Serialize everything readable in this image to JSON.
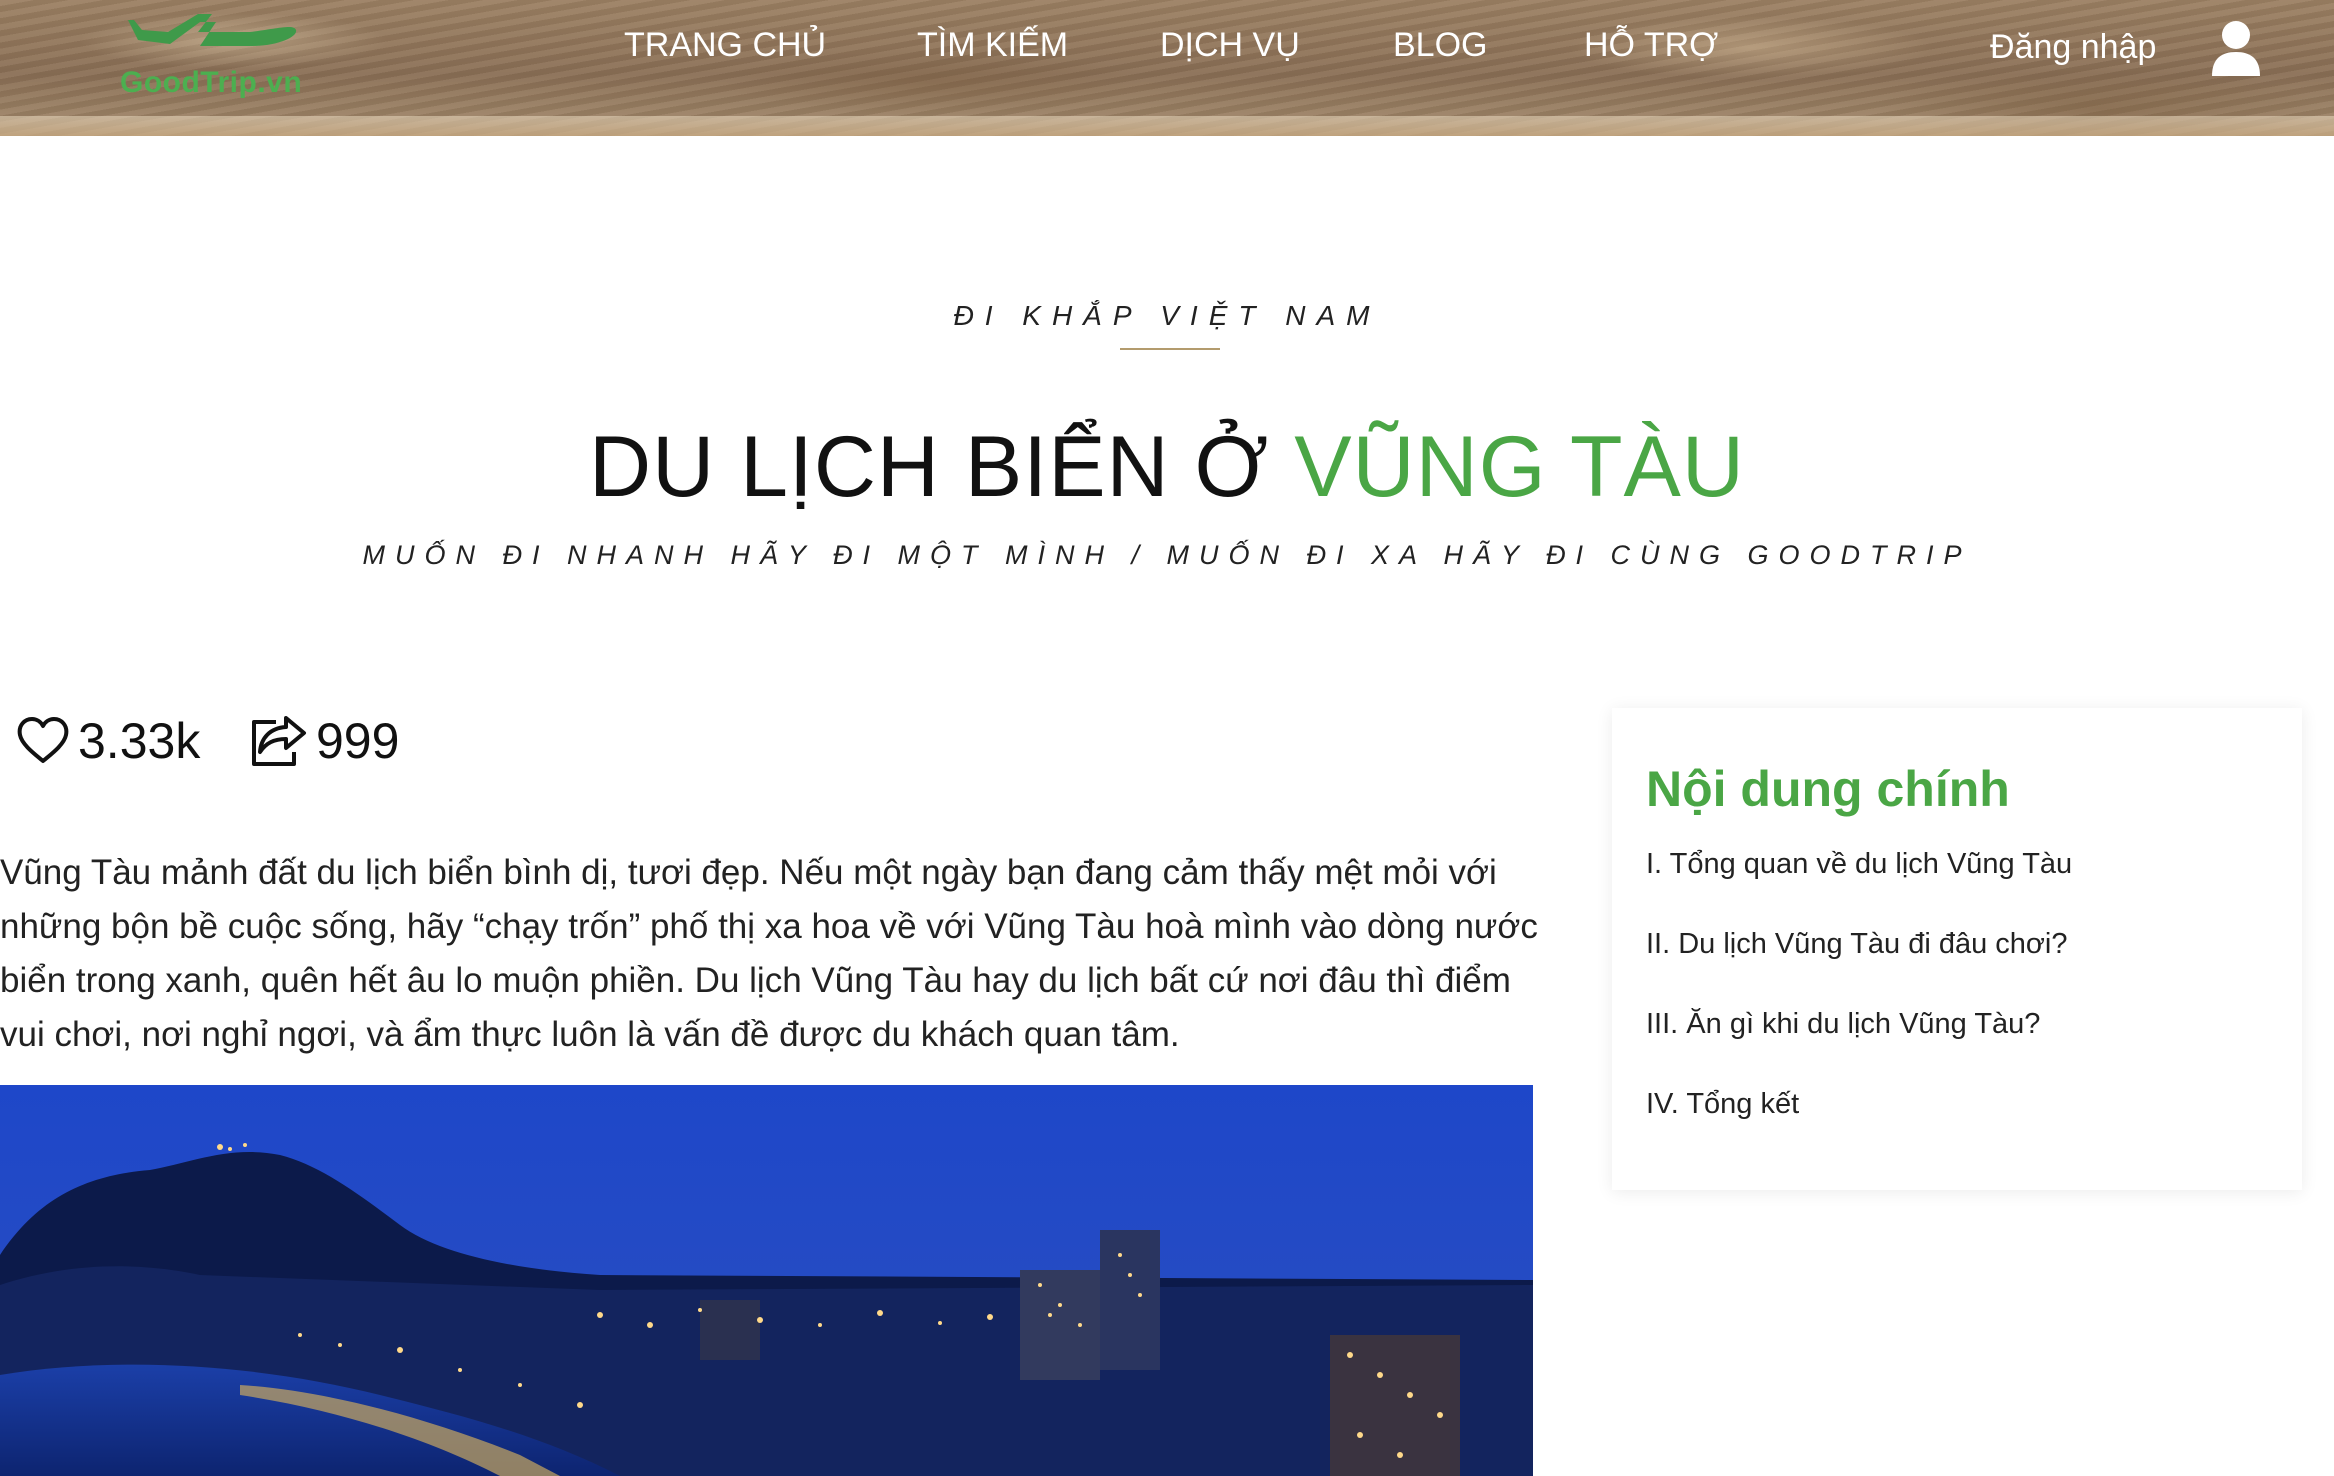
{
  "header": {
    "logo_text": "GoodTrip.vn",
    "nav": [
      {
        "label": "TRANG CHỦ"
      },
      {
        "label": "TÌM KIẾM"
      },
      {
        "label": "DỊCH VỤ"
      },
      {
        "label": "BLOG"
      },
      {
        "label": "HỖ TRỢ"
      }
    ],
    "login_label": "Đăng nhập",
    "icons": {
      "logo": "airplane-icon",
      "user": "user-icon"
    }
  },
  "hero": {
    "eyebrow": "ĐI KHẮP VIỆT NAM",
    "title_main": "DU LỊCH BIỂN Ở ",
    "title_accent": "VŨNG TÀU",
    "subtitle": "MUỐN ĐI NHANH HÃY ĐI MỘT MÌNH / MUỐN ĐI XA HÃY ĐI CÙNG GOODTRIP"
  },
  "stats": {
    "likes": "3.33k",
    "shares": "999",
    "icons": {
      "likes": "heart-icon",
      "shares": "share-icon"
    }
  },
  "article": {
    "intro": "Vũng Tàu mảnh đất du lịch biển bình dị, tươi đẹp. Nếu một ngày bạn đang cảm thấy mệt mỏi với những bộn bề cuộc sống, hãy “chạy trốn” phố thị xa hoa về với Vũng Tàu hoà mình vào dòng nước biển trong xanh, quên hết âu lo muộn phiền. Du lịch Vũng Tàu hay du lịch bất cứ nơi đâu thì điểm vui chơi, nơi nghỉ ngơi, và ẩm thực luôn là vấn đề được du khách quan tâm."
  },
  "toc": {
    "title": "Nội dung chính",
    "items": [
      {
        "label": "I. Tổng quan về du lịch Vũng Tàu"
      },
      {
        "label": "II. Du lịch Vũng Tàu đi đâu chơi?"
      },
      {
        "label": "III. Ăn gì khi du lịch Vũng Tàu?"
      },
      {
        "label": "IV. Tổng kết"
      }
    ]
  },
  "colors": {
    "accent": "#4aa645",
    "divider": "#b39b6d"
  }
}
